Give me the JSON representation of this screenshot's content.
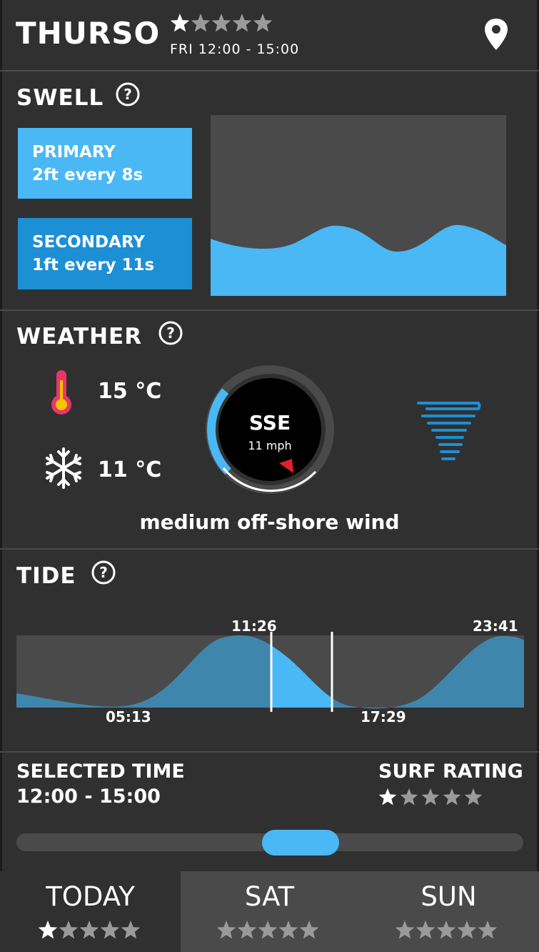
{
  "header": {
    "location": "THURSO",
    "rating": 1,
    "rating_max": 5,
    "time_window": "FRI 12:00 - 15:00",
    "pin_icon": "location-pin-icon"
  },
  "swell": {
    "title": "SWELL",
    "primary": {
      "title": "PRIMARY",
      "detail": "2ft every 8s"
    },
    "secondary": {
      "title": "SECONDARY",
      "detail": "1ft every 11s"
    }
  },
  "weather": {
    "title": "WEATHER",
    "temp_high": "15 °C",
    "temp_low": "11 °C",
    "wind_direction": "SSE",
    "wind_speed": "11 mph",
    "wind_description": "medium off-shore wind"
  },
  "tide": {
    "title": "TIDE",
    "high_1": "11:26",
    "high_2": "23:41",
    "low_1": "05:13",
    "low_2": "17:29"
  },
  "selection": {
    "selected_label": "SELECTED TIME",
    "selected_value": "12:00 - 15:00",
    "rating_label": "SURF RATING",
    "rating": 1,
    "rating_max": 5
  },
  "days": [
    {
      "label": "TODAY",
      "rating": 1,
      "active": true
    },
    {
      "label": "SAT",
      "rating": 0,
      "active": false
    },
    {
      "label": "SUN",
      "rating": 0,
      "active": false
    }
  ],
  "colors": {
    "background": "#303030",
    "chart_background": "#4a4a4a",
    "accent": "#49b8f5",
    "accent_dark": "#1d8fd5",
    "star_on": "#ffffff",
    "star_off": "#9a9a9a",
    "thermometer": "#e8366a",
    "compass_marker": "#e0202a"
  }
}
